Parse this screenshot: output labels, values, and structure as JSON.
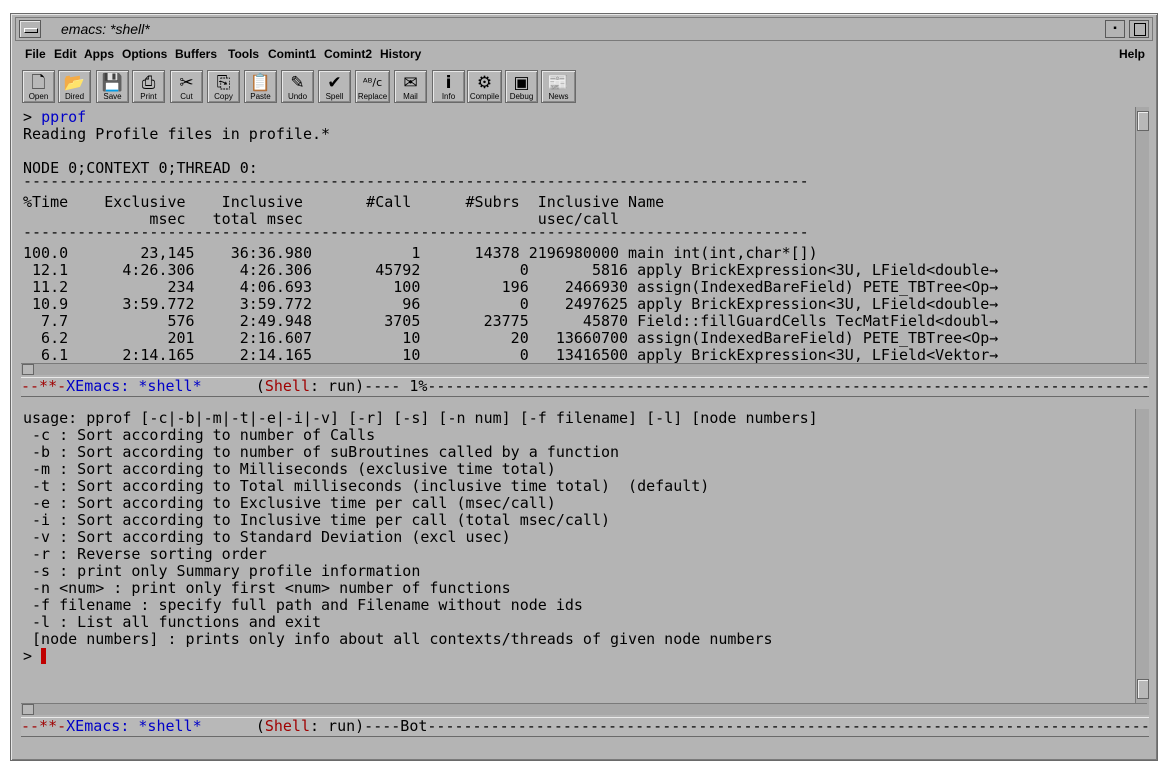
{
  "window": {
    "title": "emacs: *shell*"
  },
  "menu": {
    "items": [
      "File",
      "Edit",
      "Apps",
      "Options",
      "Buffers",
      "Tools",
      "Comint1",
      "Comint2",
      "History"
    ],
    "help": "Help"
  },
  "toolbar": {
    "buttons": [
      {
        "label": "Open",
        "icon": "open-file-icon"
      },
      {
        "label": "Dired",
        "icon": "folder-icon"
      },
      {
        "label": "Save",
        "icon": "floppy-icon"
      },
      {
        "label": "Print",
        "icon": "printer-icon"
      },
      {
        "label": "Cut",
        "icon": "scissors-icon"
      },
      {
        "label": "Copy",
        "icon": "copy-icon"
      },
      {
        "label": "Paste",
        "icon": "clipboard-icon"
      },
      {
        "label": "Undo",
        "icon": "undo-icon"
      },
      {
        "label": "Spell",
        "icon": "spell-check-icon"
      },
      {
        "label": "Replace",
        "icon": "replace-icon"
      },
      {
        "label": "Mail",
        "icon": "mail-icon"
      },
      {
        "label": "Info",
        "icon": "info-icon"
      },
      {
        "label": "Compile",
        "icon": "compile-icon"
      },
      {
        "label": "Debug",
        "icon": "debug-icon"
      },
      {
        "label": "News",
        "icon": "news-icon"
      }
    ]
  },
  "top_pane": {
    "prompt": ">",
    "command": "pprof",
    "reading": "Reading Profile files in profile.*",
    "node_line": "NODE 0;CONTEXT 0;THREAD 0:",
    "separator": "---------------------------------------------------------------------------------------",
    "header1": "%Time    Exclusive    Inclusive       #Call      #Subrs  Inclusive Name",
    "header2": "              msec   total msec                          usec/call",
    "rows": [
      "100.0        23,145    36:36.980           1      14378 2196980000 main int(int,char*[])",
      " 12.1      4:26.306     4:26.306       45792           0       5816 apply BrickExpression<3U, LField<double",
      " 11.2           234     4:06.693         100         196    2466930 assign(IndexedBareField) PETE_TBTree<Op",
      " 10.9      3:59.772     3:59.772          96           0    2497625 apply BrickExpression<3U, LField<double",
      "  7.7           576     2:49.948        3705       23775      45870 Field::fillGuardCells TecMatField<doubl",
      "  6.2           201     2:16.607          10          20   13660700 assign(IndexedBareField) PETE_TBTree<Op",
      "  6.1      2:14.165     2:14.165          10           0   13416500 apply BrickExpression<3U, LField<Vektor"
    ],
    "wrap_glyph": "→"
  },
  "modeline_top": {
    "flags": "--**-",
    "buffer": "XEmacs: *shell*",
    "gap": "      ",
    "mode_open": "(",
    "mode_name": "Shell",
    "mode_rest": ": run)---- 1%",
    "fill": "-----------------------------------------------------------------------------------------------------"
  },
  "bottom_pane": {
    "lines": [
      "usage: pprof [-c|-b|-m|-t|-e|-i|-v] [-r] [-s] [-n num] [-f filename] [-l] [node numbers]",
      " -c : Sort according to number of Calls",
      " -b : Sort according to number of suBroutines called by a function",
      " -m : Sort according to Milliseconds (exclusive time total)",
      " -t : Sort according to Total milliseconds (inclusive time total)  (default)",
      " -e : Sort according to Exclusive time per call (msec/call)",
      " -i : Sort according to Inclusive time per call (total msec/call)",
      " -v : Sort according to Standard Deviation (excl usec)",
      " -r : Reverse sorting order",
      " -s : print only Summary profile information",
      " -n <num> : print only first <num> number of functions",
      " -f filename : specify full path and Filename without node ids",
      " -l : List all functions and exit",
      " [node numbers] : prints only info about all contexts/threads of given node numbers"
    ],
    "prompt": "> "
  },
  "modeline_bottom": {
    "flags": "--**-",
    "buffer": "XEmacs: *shell*",
    "gap": "      ",
    "mode_open": "(",
    "mode_name": "Shell",
    "mode_rest": ": run)----Bot",
    "fill": "-----------------------------------------------------------------------------------------------------"
  },
  "colors": {
    "background": "#b4b4b4",
    "mode_name": "#a00000",
    "buffer_name": "#0000c8",
    "cursor": "#c00000"
  }
}
